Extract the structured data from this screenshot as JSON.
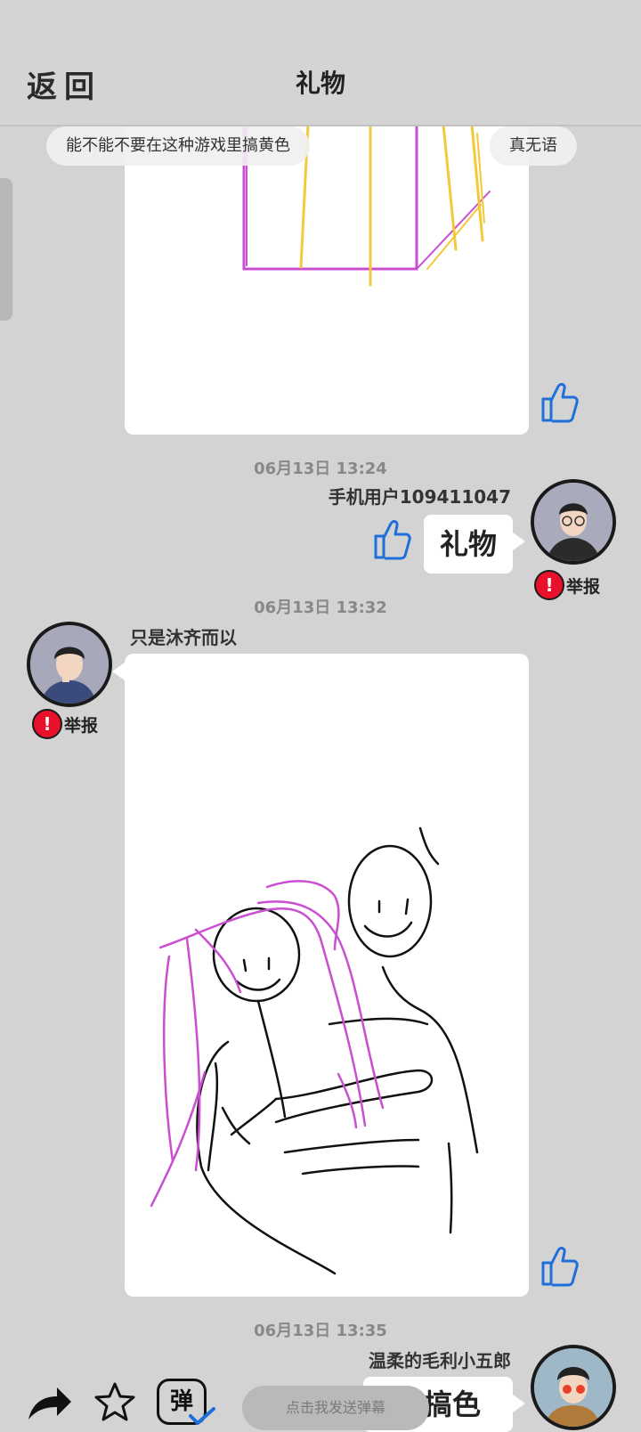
{
  "header": {
    "back_label": "返回",
    "title": "礼物"
  },
  "danmaku": [
    "能不能不要在这种游戏里搞黄色",
    "真无语"
  ],
  "messages": [
    {
      "timestamp": "06月13日  13:24",
      "username": "手机用户109411047",
      "bubble_text": "礼物",
      "report_label": "举报"
    },
    {
      "timestamp": "06月13日  13:32",
      "username": "只是沐齐而以",
      "report_label": "举报"
    },
    {
      "timestamp": "06月13日  13:35",
      "username": "温柔的毛利小五郎",
      "bubble_text": "去搞色"
    }
  ],
  "bottom": {
    "danmaku_placeholder": "点击我发送弹幕",
    "danmaku_button_label": "弹"
  },
  "colors": {
    "background": "#d3d3d3",
    "accent_blue": "#1e6fd9",
    "report_red": "#e8102a",
    "drawing_magenta": "#c94fd0",
    "drawing_yellow": "#f2c93a"
  }
}
